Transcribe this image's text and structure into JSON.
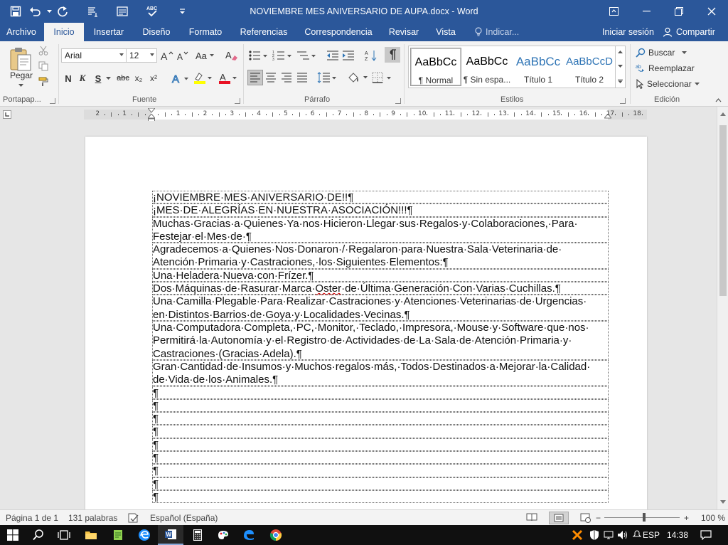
{
  "window": {
    "title": "NOVIEMBRE MES ANIVERSARIO DE AUPA.docx - Word"
  },
  "quick_access": {
    "icons": [
      "save-icon",
      "undo-icon",
      "redo-icon",
      "paragraph-marks-icon",
      "form-icon",
      "spelling-icon",
      "customize-qat-icon"
    ]
  },
  "tabs": [
    {
      "label": "Archivo",
      "active": false
    },
    {
      "label": "Inicio",
      "active": true
    },
    {
      "label": "Insertar",
      "active": false
    },
    {
      "label": "Diseño",
      "active": false
    },
    {
      "label": "Formato",
      "active": false
    },
    {
      "label": "Referencias",
      "active": false
    },
    {
      "label": "Correspondencia",
      "active": false
    },
    {
      "label": "Revisar",
      "active": false
    },
    {
      "label": "Vista",
      "active": false
    }
  ],
  "tell_me": "Indicar...",
  "sign_in": "Iniciar sesión",
  "share": "Compartir",
  "ribbon": {
    "clipboard": {
      "paste_label": "Pegar",
      "group_label": "Portapap..."
    },
    "font": {
      "font_name": "Arial",
      "font_size": "12",
      "group_label": "Fuente",
      "buttons": [
        "N",
        "K",
        "S",
        "abc",
        "x₂",
        "x²"
      ],
      "highlight_color": "#ffff00",
      "font_color": "#e81123"
    },
    "paragraph": {
      "group_label": "Párrafo"
    },
    "styles": {
      "group_label": "Estilos",
      "items": [
        {
          "preview": "AaBbCc",
          "name": "¶ Normal",
          "selected": true,
          "color": "#000000"
        },
        {
          "preview": "AaBbCc",
          "name": "¶ Sin espa...",
          "selected": false,
          "color": "#000000"
        },
        {
          "preview": "AaBbCc",
          "name": "Título 1",
          "selected": false,
          "color": "#2e74b5"
        },
        {
          "preview": "AaBbCcD",
          "name": "Título 2",
          "selected": false,
          "color": "#2e74b5"
        }
      ]
    },
    "editing": {
      "group_label": "Edición",
      "find": "Buscar",
      "replace": "Reemplazar",
      "select": "Seleccionar"
    }
  },
  "document": {
    "paragraphs": [
      {
        "lines": [
          "¡NOVIEMBRE·MES·ANIVERSARIO·DE!!¶"
        ]
      },
      {
        "lines": [
          "¡MES·DE·ALEGRÍAS·EN·NUESTRA·ASOCIACIÓN!!!¶"
        ]
      },
      {
        "lines": [
          "Muchas·Gracias·a·Quienes·Ya·nos·Hicieron·Llegar·sus·Regalos·y·Colaboraciones,·Para·",
          "Festejar·el·Mes·de·¶"
        ]
      },
      {
        "lines": [
          "Agradecemos·a·Quienes·Nos·Donaron·/·Regalaron·para·Nuestra·Sala·Veterinaria·de·",
          "Atención·Primaria·y·Castraciones,·los·Siguientes·Elementos:¶"
        ]
      },
      {
        "lines": [
          "Una·Heladera·Nueva·con·Frízer.¶"
        ]
      },
      {
        "lines": [
          "Dos·Máquinas·de·Rasurar·Marca·Oster·de·Última·Generación·Con·Varias·Cuchillas.¶"
        ]
      },
      {
        "lines": [
          "Una·Camilla·Plegable·Para·Realizar·Castraciones·y·Atenciones·Veterinarias·de·Urgencias·",
          "en·Distintos·Barrios·de·Goya·y·Localidades·Vecinas.¶"
        ]
      },
      {
        "lines": [
          "Una·Computadora·Completa,·PC,·Monitor,·Teclado,·Impresora,·Mouse·y·Software·que·nos·",
          "Permitirá·la·Autonomía·y·el·Registro·de·Actividades·de·La·Sala·de·Atención·Primaria·y·",
          "Castraciones·(Gracias·Adela).¶"
        ]
      },
      {
        "lines": [
          "Gran·Cantidad·de·Insumos·y·Muchos·regalos·más,·Todos·Destinados·a·Mejorar·la·Calidad·",
          "de·Vida·de·los·Animales.¶"
        ]
      },
      {
        "lines": [
          "¶"
        ]
      },
      {
        "lines": [
          "¶"
        ]
      },
      {
        "lines": [
          "¶"
        ]
      },
      {
        "lines": [
          "¶"
        ]
      },
      {
        "lines": [
          "¶"
        ]
      },
      {
        "lines": [
          "¶"
        ]
      },
      {
        "lines": [
          "¶"
        ]
      },
      {
        "lines": [
          "¶"
        ]
      },
      {
        "lines": [
          "¶"
        ]
      }
    ]
  },
  "ruler": {
    "h_numbers": [
      "2",
      "1",
      "1",
      "2",
      "3",
      "4",
      "5",
      "6",
      "7",
      "8",
      "9",
      "10",
      "11",
      "12",
      "13",
      "14",
      "15",
      "16",
      "17",
      "18"
    ],
    "v_numbers": [
      "2",
      "1",
      "1",
      "2",
      "3",
      "4",
      "5",
      "6",
      "7",
      "8",
      "9",
      "10",
      "11"
    ]
  },
  "status": {
    "page": "Página 1 de 1",
    "words": "131 palabras",
    "language": "Español (España)",
    "zoom": "100 %"
  },
  "taskbar": {
    "language": "ESP",
    "time": "14:38"
  }
}
